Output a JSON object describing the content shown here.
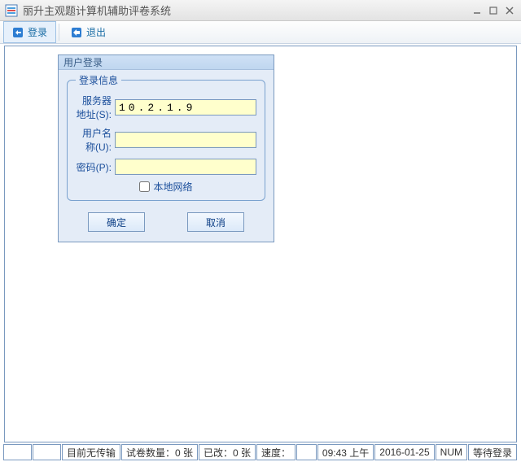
{
  "window": {
    "title": "丽升主观题计算机辅助评卷系统"
  },
  "toolbar": {
    "login_label": "登录",
    "exit_label": "退出"
  },
  "dialog": {
    "title": "用户登录",
    "group_title": "登录信息",
    "server_label": "服务器地址(S):",
    "server_value": "10.2.1.9",
    "user_label": "用户名称(U):",
    "user_value": "",
    "password_label": "密码(P):",
    "password_value": "",
    "local_net_label": "本地网络",
    "ok_label": "确定",
    "cancel_label": "取消"
  },
  "status": {
    "transfer": "目前无传输",
    "count": "试卷数量：0 张",
    "changed": "已改：0 张",
    "speed": "速度：",
    "time": "09:43 上午",
    "date": "2016-01-25",
    "num": "NUM",
    "wait": "等待登录"
  }
}
